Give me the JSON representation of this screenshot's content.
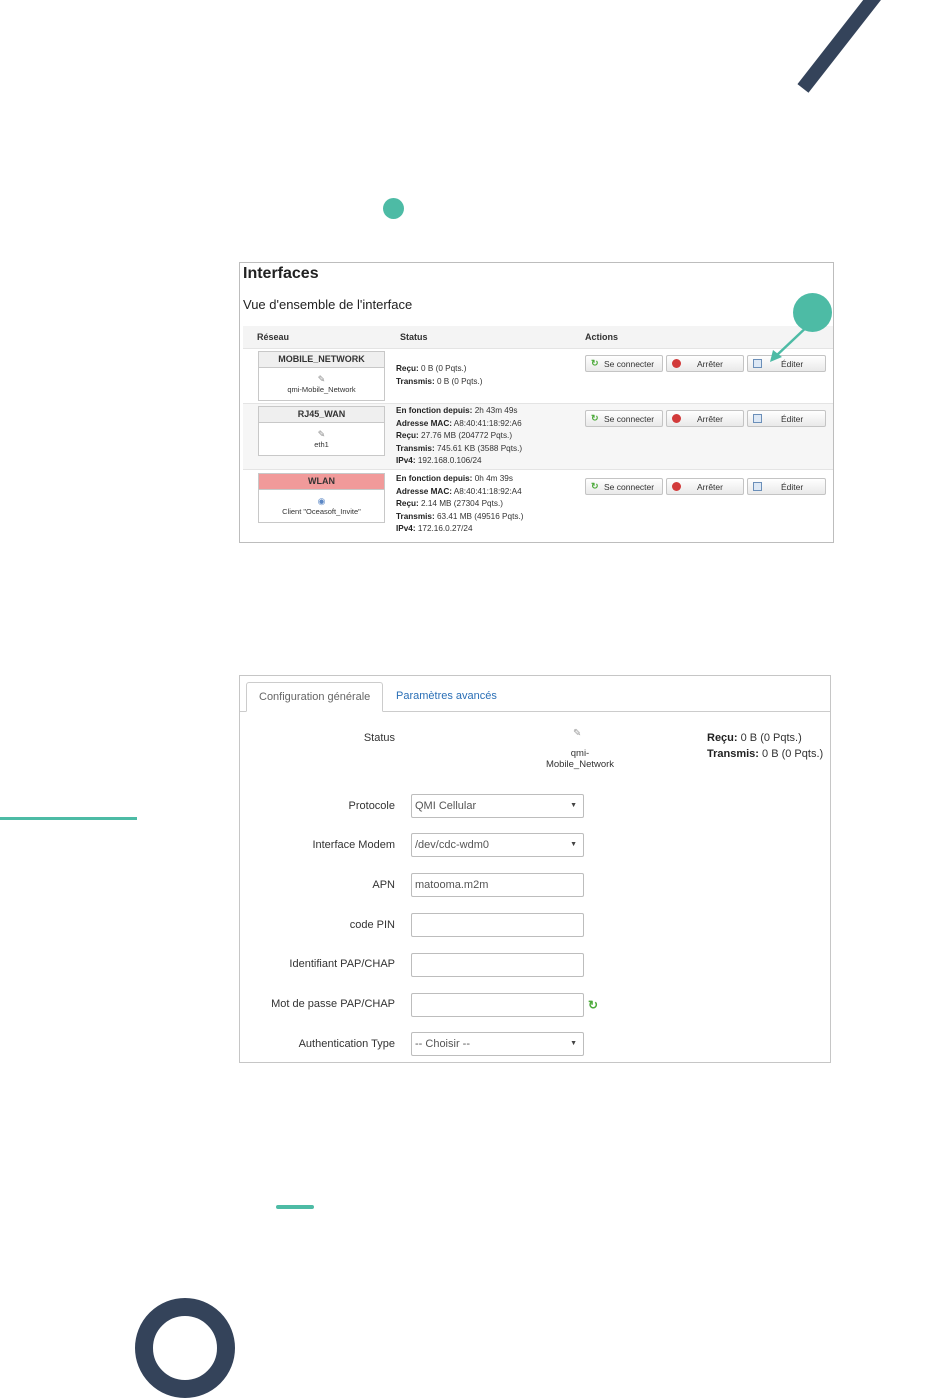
{
  "colors": {
    "accent": "#4dbba5",
    "navy": "#34435a",
    "wlan_badge": "#f19a9a",
    "link": "#2a6fb6"
  },
  "interfaces": {
    "title": "Interfaces",
    "subtitle": "Vue d'ensemble de l'interface",
    "columns": {
      "network": "Réseau",
      "status": "Status",
      "actions": "Actions"
    },
    "buttons": {
      "connect": "Se connecter",
      "stop": "Arrêter",
      "edit": "Éditer"
    },
    "rows": [
      {
        "name": "MOBILE_NETWORK",
        "device": "qmi-Mobile_Network",
        "recu_label": "Reçu:",
        "recu": "0 B (0 Pqts.)",
        "transmis_label": "Transmis:",
        "transmis": "0 B (0 Pqts.)"
      },
      {
        "name": "RJ45_WAN",
        "device": "eth1",
        "uptime_label": "En fonction depuis:",
        "uptime": "2h 43m 49s",
        "mac_label": "Adresse MAC:",
        "mac": "A8:40:41:18:92:A6",
        "recu_label": "Reçu:",
        "recu": "27.76 MB (204772 Pqts.)",
        "transmis_label": "Transmis:",
        "transmis": "745.61 KB (3588 Pqts.)",
        "ipv4_label": "IPv4:",
        "ipv4": "192.168.0.106/24"
      },
      {
        "name": "WLAN",
        "device": "Client \"Oceasoft_Invite\"",
        "uptime_label": "En fonction depuis:",
        "uptime": "0h 4m 39s",
        "mac_label": "Adresse MAC:",
        "mac": "A8:40:41:18:92:A4",
        "recu_label": "Reçu:",
        "recu": "2.14 MB (27304 Pqts.)",
        "transmis_label": "Transmis:",
        "transmis": "63.41 MB (49516 Pqts.)",
        "ipv4_label": "IPv4:",
        "ipv4": "172.16.0.27/24"
      }
    ]
  },
  "config": {
    "tabs": {
      "general": "Configuration générale",
      "advanced": "Paramètres avancés"
    },
    "status": {
      "label": "Status",
      "device": "qmi-Mobile_Network",
      "recu_label": "Reçu:",
      "recu": "0 B (0 Pqts.)",
      "transmis_label": "Transmis:",
      "transmis": "0 B (0 Pqts.)"
    },
    "fields": {
      "protocole": {
        "label": "Protocole",
        "value": "QMI Cellular"
      },
      "modem": {
        "label": "Interface Modem",
        "value": "/dev/cdc-wdm0"
      },
      "apn": {
        "label": "APN",
        "value": "matooma.m2m"
      },
      "pin": {
        "label": "code PIN",
        "value": ""
      },
      "user": {
        "label": "Identifiant PAP/CHAP",
        "value": ""
      },
      "password": {
        "label": "Mot de passe PAP/CHAP",
        "value": ""
      },
      "auth": {
        "label": "Authentication Type",
        "value": "-- Choisir --"
      }
    }
  }
}
